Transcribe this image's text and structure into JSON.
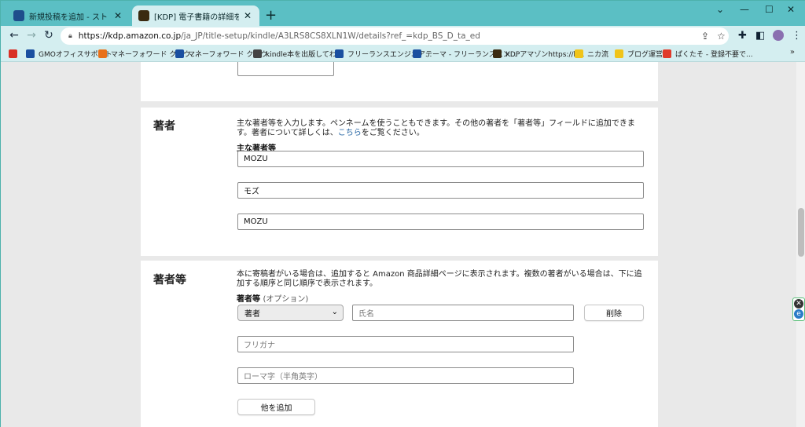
{
  "browser": {
    "tabs": [
      {
        "title": "新規投稿を追加 - ストレスフリーに生",
        "favicon_color": "#1e4e8c"
      },
      {
        "title": "[KDP] 電子書籍の詳細を編集 | Ama",
        "favicon_color": "#3a2a10"
      }
    ],
    "new_tab": "+",
    "window_controls": {
      "collapse": "⌄",
      "minimize": "—",
      "maximize": "☐",
      "close": "✕"
    },
    "nav": {
      "back": "←",
      "forward": "→",
      "reload": "↻"
    },
    "url": {
      "host": "https://kdp.amazon.co.jp",
      "path": "/ja_JP/title-setup/kindle/A3LRS8CS8XLN1W/details?ref_=kdp_BS_D_ta_ed"
    },
    "bookmarks": [
      {
        "label": "",
        "icon": "gmail-icon",
        "color": "#d93025"
      },
      {
        "label": "GMOオフィスサポート",
        "color": "#1a4fa0"
      },
      {
        "label": "マネーフォワード クラウ...",
        "color": "#e8711a"
      },
      {
        "label": "マネーフォワード クラウ...",
        "color": "#1a4fa0"
      },
      {
        "label": "kindle本を出版してわ...",
        "color": "#444444"
      },
      {
        "label": "フリーランスエンジニア...",
        "color": "#1a4fa0"
      },
      {
        "label": "テーマ - フリーランスエン...",
        "color": "#1a4fa0"
      },
      {
        "label": "KDPアマゾンhttps://k...",
        "color": "#3a2a10"
      },
      {
        "label": "ニカ流",
        "color": "#f0c419"
      },
      {
        "label": "ブログ運営",
        "color": "#f0c419"
      },
      {
        "label": "ぱくたそ - 登録不要で...",
        "color": "#e03a2a"
      }
    ],
    "bookmarks_more": "»"
  },
  "page": {
    "authors": {
      "title": "著者",
      "description": "主な著者等を入力します。ペンネームを使うこともできます。その他の著者を「著者等」フィールドに追加できます。著者について詳しくは、",
      "link": "こちら",
      "description_end": "をご覧ください。",
      "label": "主な著者等",
      "name": "MOZU",
      "kana": "モズ",
      "romaji": "MOZU"
    },
    "contributors": {
      "title": "著者等",
      "description": "本に寄稿者がいる場合は、追加すると Amazon 商品詳細ページに表示されます。複数の著者がいる場合は、下に追加する順序と同じ順序で表示されます。",
      "label": "著者等",
      "label_optional": "(オプション)",
      "role_selected": "著者",
      "name_placeholder": "氏名",
      "kana_placeholder": "フリガナ",
      "romaji_placeholder": "ローマ字（半角英字）",
      "delete_label": "削除",
      "add_label": "他を追加"
    }
  }
}
